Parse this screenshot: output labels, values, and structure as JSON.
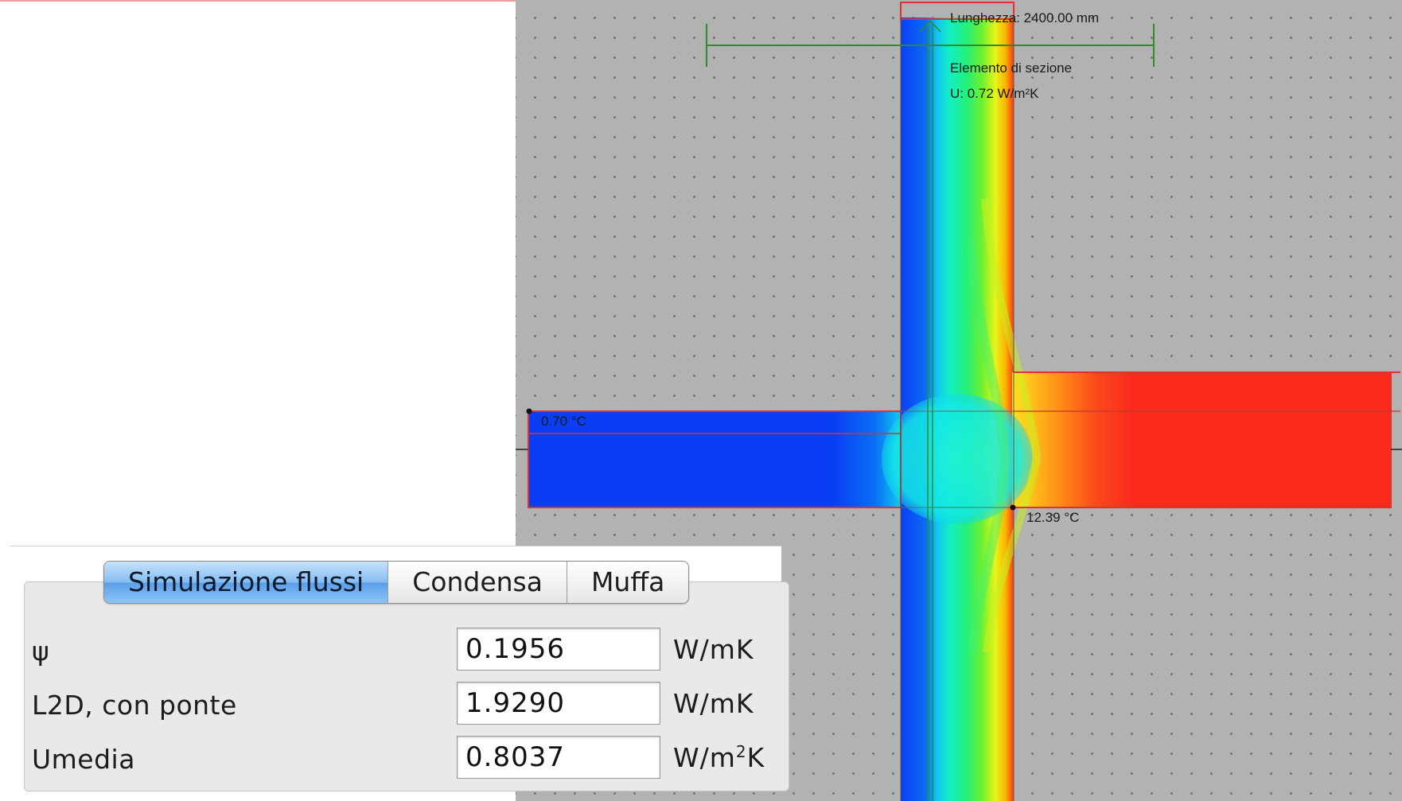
{
  "canvas": {
    "length_label": "Lunghezza: 2400.00 mm",
    "element_label": "Elemento di sezione",
    "u_label": "U: 0.72 W/m²K",
    "temp_min_label": "0.70 °C",
    "temp_max_label": "12.39 °C",
    "colors": {
      "background": "#b2b2b2",
      "cold": "#0a3ef5",
      "warm": "#fa2a1c",
      "outline": "#e03030",
      "dimension": "#2e8b2e"
    }
  },
  "tabs": [
    {
      "label": "Simulazione flussi",
      "active": true
    },
    {
      "label": "Condensa",
      "active": false
    },
    {
      "label": "Muffa",
      "active": false
    }
  ],
  "results": [
    {
      "label": "ψ",
      "value": "0.1956",
      "unit": "W/mK"
    },
    {
      "label": "L2D, con ponte",
      "value": "1.9290",
      "unit": "W/mK"
    },
    {
      "label": "Umedia",
      "value": "0.8037",
      "unit_base": "W/m",
      "unit_exp": "2",
      "unit_tail": "K"
    }
  ]
}
